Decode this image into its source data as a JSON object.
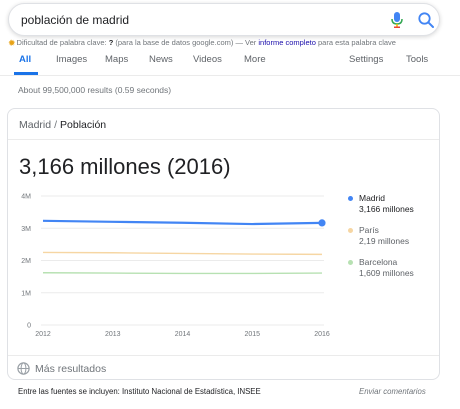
{
  "search": {
    "query": "población de madrid"
  },
  "keyword_tip": {
    "label": "Dificultad de palabra clave: ",
    "value": "?",
    "paren": " (para la base de datos google.com) — Ver ",
    "link": "informe completo",
    "suffix": " para esta palabra clave"
  },
  "tabs": [
    "All",
    "Images",
    "Maps",
    "News",
    "Videos",
    "More",
    "Settings",
    "Tools"
  ],
  "result_stats": "About 99,500,000 results (0.59 seconds)",
  "card": {
    "crumb_1": "Madrid",
    "crumb_sep": "/",
    "crumb_2": "Población",
    "headline": "3,166 millones (2016)",
    "more_results": "Más resultados"
  },
  "chart_data": {
    "type": "line",
    "x": [
      "2012",
      "2013",
      "2014",
      "2015",
      "2016"
    ],
    "y_ticks": [
      "0",
      "1M",
      "2M",
      "3M",
      "4M"
    ],
    "ylim": [
      0,
      4
    ],
    "y_unit": "millones",
    "series": [
      {
        "name": "Madrid",
        "display": "3,166 millones",
        "color": "#4285f4",
        "values": [
          3.23,
          3.2,
          3.17,
          3.13,
          3.166
        ],
        "highlight": true
      },
      {
        "name": "París",
        "display": "2,19 millones",
        "color": "#f6d6a3",
        "values": [
          2.25,
          2.24,
          2.22,
          2.2,
          2.19
        ],
        "highlight": false
      },
      {
        "name": "Barcelona",
        "display": "1,609 millones",
        "color": "#b7e1b2",
        "values": [
          1.62,
          1.61,
          1.6,
          1.6,
          1.609
        ],
        "highlight": false
      }
    ]
  },
  "footer": {
    "sources": "Entre las fuentes se incluyen: Instituto Nacional de Estadística, INSEE",
    "feedback": "Enviar comentarios"
  }
}
